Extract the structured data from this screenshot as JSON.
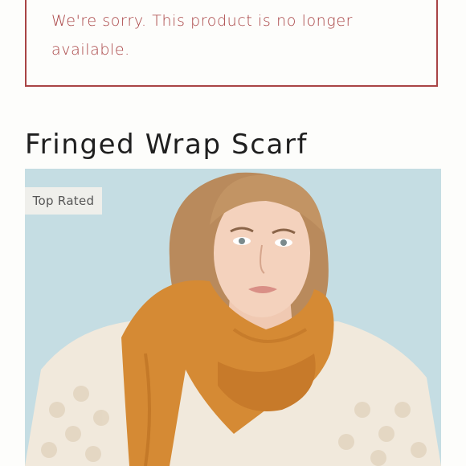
{
  "alert": {
    "message": "We're sorry. This product is no longer available."
  },
  "product": {
    "title": "Fringed Wrap Scarf",
    "badge": "Top Rated"
  },
  "colors": {
    "alert": "#a94445",
    "background": "#fdfdfb",
    "photo_backdrop": "#c5dde3",
    "scarf": "#d58a34",
    "badge_bg": "#efefeb"
  }
}
